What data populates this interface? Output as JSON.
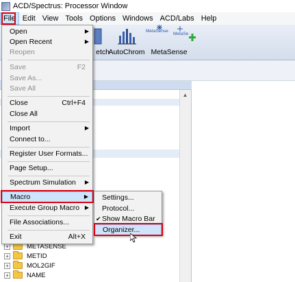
{
  "window": {
    "title": "ACD/Spectrus: Processor Window"
  },
  "menubar": {
    "items": [
      "File",
      "Edit",
      "View",
      "Tools",
      "Options",
      "Windows",
      "ACD/Labs",
      "Help"
    ]
  },
  "toolbar": {
    "partial_label": "etch",
    "autochrom_label": "AutoChrom",
    "metasense_label": "MetaSense",
    "metasense_icon_text_1": "MetaSense",
    "metasense_icon_text_2": "MetaSe"
  },
  "file_menu": {
    "items": [
      {
        "label": "Open",
        "shortcut": "",
        "submenu": true,
        "disabled": false
      },
      {
        "label": "Open Recent",
        "shortcut": "",
        "submenu": true,
        "disabled": false
      },
      {
        "label": "Reopen",
        "shortcut": "",
        "submenu": false,
        "disabled": true
      },
      {
        "label": "Save",
        "shortcut": "F2",
        "submenu": false,
        "disabled": true
      },
      {
        "label": "Save As...",
        "shortcut": "",
        "submenu": false,
        "disabled": true
      },
      {
        "label": "Save All",
        "shortcut": "",
        "submenu": false,
        "disabled": true
      },
      {
        "label": "Close",
        "shortcut": "Ctrl+F4",
        "submenu": false,
        "disabled": false
      },
      {
        "label": "Close All",
        "shortcut": "",
        "submenu": false,
        "disabled": false
      },
      {
        "label": "Import",
        "shortcut": "",
        "submenu": true,
        "disabled": false
      },
      {
        "label": "Connect to...",
        "shortcut": "",
        "submenu": false,
        "disabled": false
      },
      {
        "label": "Register User Formats...",
        "shortcut": "",
        "submenu": false,
        "disabled": false
      },
      {
        "label": "Page Setup...",
        "shortcut": "",
        "submenu": false,
        "disabled": false
      },
      {
        "label": "Spectrum Simulation",
        "shortcut": "",
        "submenu": true,
        "disabled": false
      },
      {
        "label": "Macro",
        "shortcut": "",
        "submenu": true,
        "disabled": false
      },
      {
        "label": "Execute Group Macro",
        "shortcut": "",
        "submenu": true,
        "disabled": false
      },
      {
        "label": "File Associations...",
        "shortcut": "",
        "submenu": false,
        "disabled": false
      },
      {
        "label": "Exit",
        "shortcut": "Alt+X",
        "submenu": false,
        "disabled": false
      }
    ]
  },
  "macro_menu": {
    "items": [
      {
        "label": "Settings...",
        "checked": false
      },
      {
        "label": "Protocol...",
        "checked": false
      },
      {
        "label": "Show Macro Bar",
        "checked": true
      },
      {
        "label": "Organizer...",
        "checked": false
      }
    ]
  },
  "tree": {
    "items": [
      "METASENSE",
      "METID",
      "MOL2GIF",
      "NAME"
    ]
  },
  "colors": {
    "highlight_red": "#d9000f",
    "menu_hover": "#cfe3fa",
    "folder": "#f3c742"
  }
}
